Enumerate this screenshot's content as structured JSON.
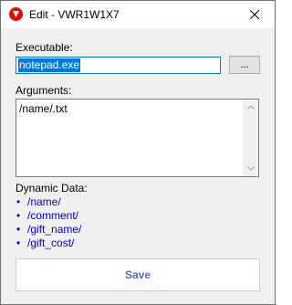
{
  "window": {
    "title": "Edit - VWR1W1X7",
    "accent": "#0078d7",
    "app_icon": "red-circle-icon"
  },
  "form": {
    "executable_label": "Executable:",
    "executable_value": "notepad.exe",
    "browse_label": "...",
    "arguments_label": "Arguments:",
    "arguments_value": "/name/.txt",
    "dynamic_label": "Dynamic Data:",
    "dynamic_items": [
      "/name/",
      "/comment/",
      "/gift_name/",
      "/gift_cost/"
    ],
    "save_label": "Save"
  }
}
